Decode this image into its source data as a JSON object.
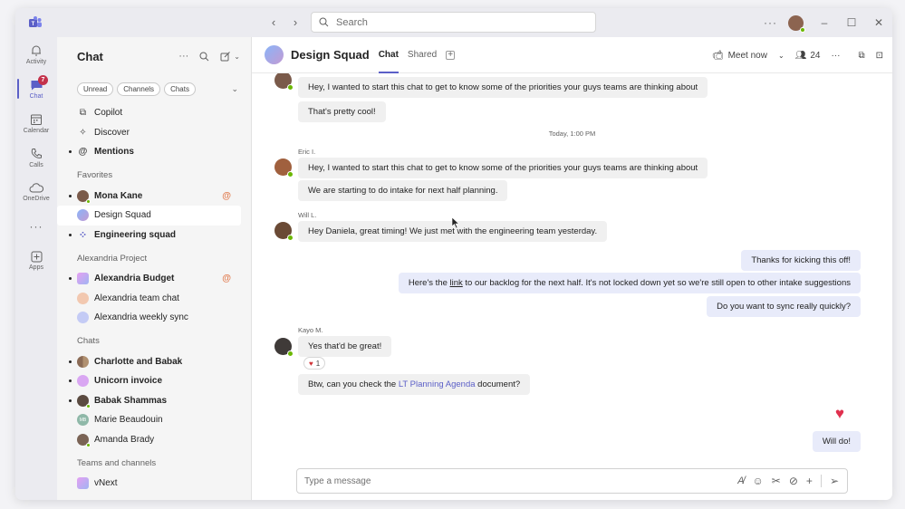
{
  "search": {
    "placeholder": "Search"
  },
  "titlebar": {
    "more_label": "···"
  },
  "rail": [
    {
      "label": "Activity",
      "icon": "bell-icon"
    },
    {
      "label": "Chat",
      "icon": "chat-icon",
      "badge": "7",
      "active": true
    },
    {
      "label": "Calendar",
      "icon": "calendar-icon"
    },
    {
      "label": "Calls",
      "icon": "phone-icon"
    },
    {
      "label": "OneDrive",
      "icon": "cloud-icon"
    },
    {
      "label": "",
      "icon": "more-icon"
    },
    {
      "label": "Apps",
      "icon": "apps-icon"
    }
  ],
  "chatlist": {
    "title": "Chat",
    "filters": [
      "Unread",
      "Channels",
      "Chats"
    ],
    "top_items": [
      {
        "label": "Copilot",
        "icon": "copilot-icon"
      },
      {
        "label": "Discover",
        "icon": "sparkle-icon"
      },
      {
        "label": "Mentions",
        "icon": "at-icon",
        "bold": true,
        "unread": true
      }
    ],
    "favorites_header": "Favorites",
    "favorites": [
      {
        "label": "Mona Kane",
        "bold": true,
        "unread": true,
        "mention": "@",
        "color": "#7a5a4a"
      },
      {
        "label": "Design Squad",
        "selected": true,
        "color": "#a9b6f2"
      },
      {
        "label": "Engineering squad",
        "bold": true,
        "unread": true,
        "color": "#5b5fc7"
      }
    ],
    "project_header": "Alexandria Project",
    "project": [
      {
        "label": "Alexandria Budget",
        "bold": true,
        "unread": true,
        "mention": "@",
        "color": "#c58cf2"
      },
      {
        "label": "Alexandria team chat",
        "color": "#f2b48c"
      },
      {
        "label": "Alexandria weekly sync",
        "color": "#a9b6f2"
      }
    ],
    "chats_header": "Chats",
    "chats": [
      {
        "label": "Charlotte and Babak",
        "bold": true,
        "unread": true,
        "color": "#8a6a55"
      },
      {
        "label": "Unicorn invoice",
        "bold": true,
        "unread": true,
        "color": "#d9a6f2"
      },
      {
        "label": "Babak Shammas",
        "bold": true,
        "unread": true,
        "color": "#5a4a40"
      },
      {
        "label": "Marie Beaudouin",
        "color": "#8fb8a8",
        "initials": "MB"
      },
      {
        "label": "Amanda Brady",
        "color": "#7a6355"
      }
    ],
    "teams_header": "Teams and channels",
    "teams": [
      {
        "label": "vNext",
        "color": "#c58cf2"
      }
    ]
  },
  "conversation": {
    "title": "Design Squad",
    "tabs": [
      "Chat",
      "Shared"
    ],
    "meet_label": "Meet now",
    "participants": "24",
    "separator": "Today, 1:00 PM",
    "authors": {
      "eric": "Eric I.",
      "will": "Will L.",
      "kayo": "Kayo M."
    },
    "messages": {
      "m1": "Hey, I wanted to start this chat to get to know some of the priorities your guys teams are thinking about",
      "m2": "That's pretty cool!",
      "m3": "Hey, I wanted to start this chat to get to know some of the priorities your guys teams are thinking about",
      "m4": "We are starting to do intake for next half planning.",
      "m5": "Hey Daniela, great timing! We just met with the engineering team yesterday.",
      "m6": "Thanks for kicking this off!",
      "m7_pre": "Here's the ",
      "m7_link": "link",
      "m7_post": " to our backlog for the next half. It's not locked down yet so we're still open to other intake suggestions",
      "m8": "Do you want to sync really quickly?",
      "m9": "Yes that'd be great!",
      "m9_reaction": "1",
      "m10_pre": "Btw, can you check the ",
      "m10_link": "LT Planning Agenda",
      "m10_post": " document?",
      "m11": "Will do!"
    },
    "composer_placeholder": "Type a message"
  },
  "colors": {
    "accent": "#5b5fc7",
    "mention": "#e17c50",
    "badge": "#c4314b",
    "presence": "#6bb700"
  }
}
